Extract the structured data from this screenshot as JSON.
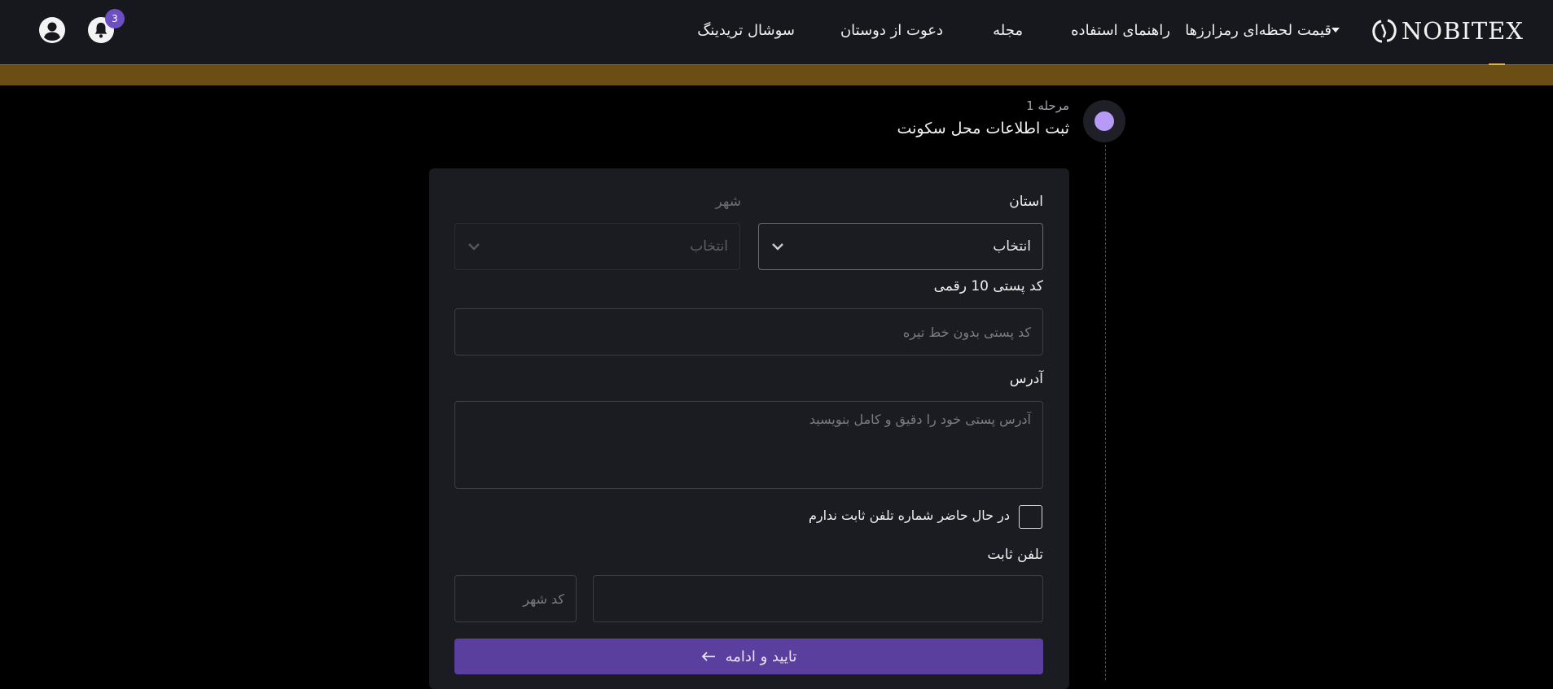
{
  "header": {
    "logo_text": "NOBITEX",
    "nav": {
      "prices": "قیمت لحظه‌ای رمزارزها",
      "guide": "راهنمای استفاده",
      "magazine": "مجله",
      "invite": "دعوت از دوستان",
      "social": "سوشال تریدینگ"
    },
    "notifications_count": "3",
    "icons": {
      "profile": "user-circle-icon",
      "notifications": "bell-icon",
      "logo": "nobitex-logo-icon"
    }
  },
  "step": {
    "number": "مرحله 1",
    "title": "ثبت اطلاعات محل سکونت"
  },
  "form": {
    "province_label": "استان",
    "province_value": "انتخاب",
    "city_label": "شهر",
    "city_value": "انتخاب",
    "postal_label": "کد پستی 10 رقمی",
    "postal_placeholder": "کد پستی بدون خط تیره",
    "address_label": "آدرس",
    "address_placeholder": "آدرس پستی خود را دقیق و کامل بنویسید",
    "no_phone_label": "در حال حاضر شماره تلفن ثابت ندارم",
    "phone_label": "تلفن ثابت",
    "phone_placeholder": "",
    "area_code_placeholder": "کد شهر",
    "submit_label": "تایید و ادامه"
  },
  "colors": {
    "accent": "#5b3f9e",
    "step_dot": "#b79af5",
    "banner": "#6b4e14",
    "header_bg": "#17181d",
    "card_bg": "#1b1c22"
  }
}
